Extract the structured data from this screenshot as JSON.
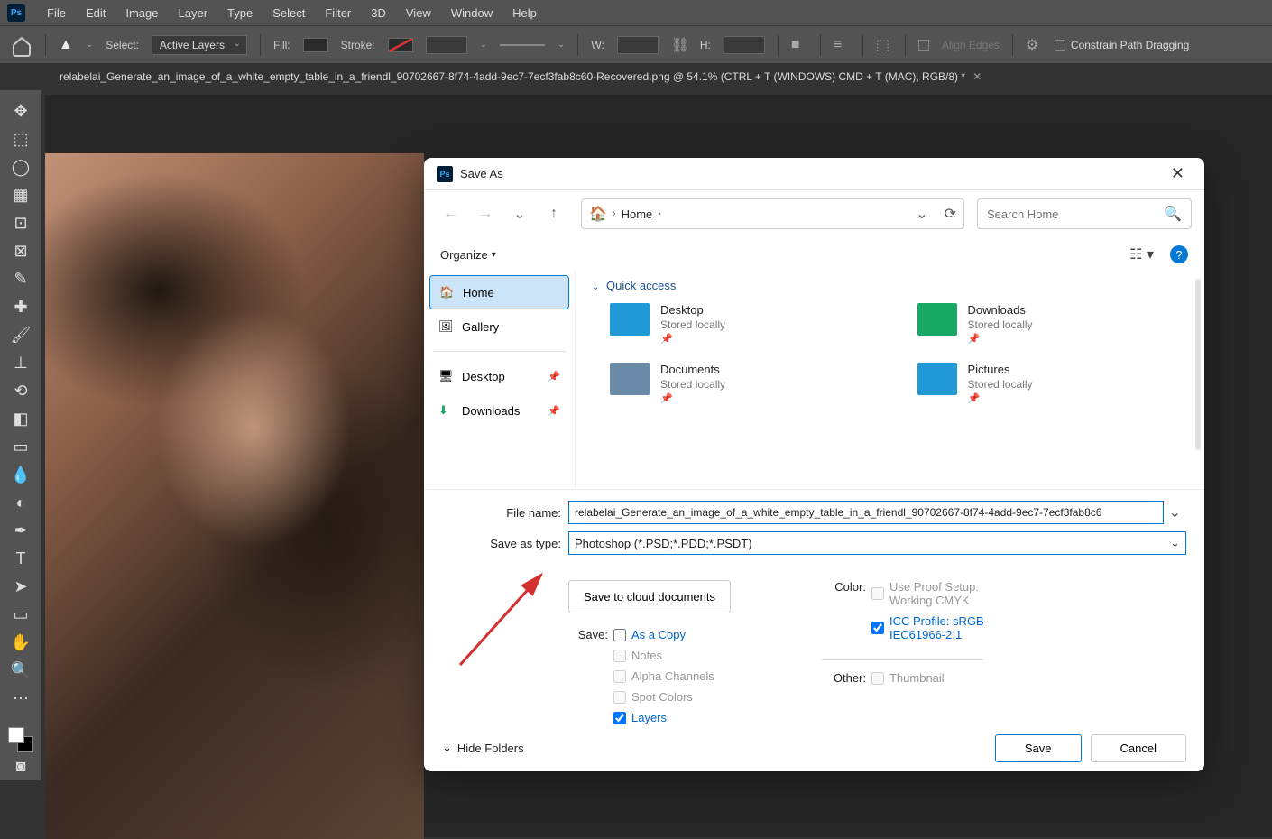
{
  "menubar": {
    "items": [
      "File",
      "Edit",
      "Image",
      "Layer",
      "Type",
      "Select",
      "Filter",
      "3D",
      "View",
      "Window",
      "Help"
    ]
  },
  "options": {
    "select_label": "Select:",
    "select_value": "Active Layers",
    "fill_label": "Fill:",
    "stroke_label": "Stroke:",
    "w_label": "W:",
    "h_label": "H:",
    "align_edges": "Align Edges",
    "constrain": "Constrain Path Dragging"
  },
  "doc_tab": "relabelai_Generate_an_image_of_a_white_empty_table_in_a_friendl_90702667-8f74-4add-9ec7-7ecf3fab8c60-Recovered.png @ 54.1% (CTRL + T (WINDOWS) CMD + T (MAC), RGB/8) *",
  "dialog": {
    "title": "Save As",
    "breadcrumb": {
      "home": "Home"
    },
    "search_placeholder": "Search Home",
    "organize": "Organize",
    "sidebar": {
      "home": "Home",
      "gallery": "Gallery",
      "desktop": "Desktop",
      "downloads": "Downloads"
    },
    "quick_access": "Quick access",
    "folders": [
      {
        "name": "Desktop",
        "loc": "Stored locally",
        "color": "#2199d6"
      },
      {
        "name": "Downloads",
        "loc": "Stored locally",
        "color": "#18a866"
      },
      {
        "name": "Documents",
        "loc": "Stored locally",
        "color": "#6b8aa8"
      },
      {
        "name": "Pictures",
        "loc": "Stored locally",
        "color": "#2199d6"
      }
    ],
    "filename_label": "File name:",
    "filename_value": "relabelai_Generate_an_image_of_a_white_empty_table_in_a_friendl_90702667-8f74-4add-9ec7-7ecf3fab8c6",
    "type_label": "Save as type:",
    "type_value": "Photoshop (*.PSD;*.PDD;*.PSDT)",
    "cloud_btn": "Save to cloud documents",
    "save_label": "Save:",
    "as_copy": "As a Copy",
    "notes": "Notes",
    "alpha": "Alpha Channels",
    "spot": "Spot Colors",
    "layers": "Layers",
    "color_label": "Color:",
    "proof": "Use Proof Setup:",
    "proof2": "Working CMYK",
    "icc": "ICC Profile:  sRGB",
    "icc2": "IEC61966-2.1",
    "other_label": "Other:",
    "thumbnail": "Thumbnail",
    "hide_folders": "Hide Folders",
    "save_btn": "Save",
    "cancel_btn": "Cancel"
  }
}
